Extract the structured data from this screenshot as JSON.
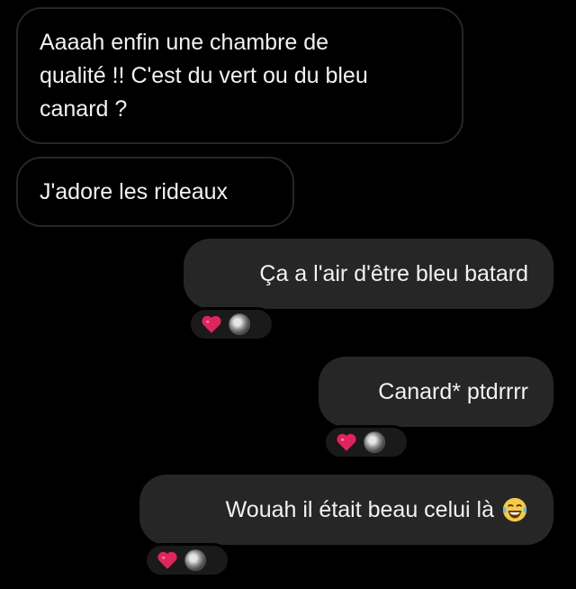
{
  "messages": [
    {
      "text": "Aaaah enfin une chambre de\nqualité !! C'est du vert ou du bleu\ncanard ?",
      "direction": "incoming"
    },
    {
      "text": "J'adore les rideaux",
      "direction": "incoming"
    },
    {
      "text": "Ça a l'air d'être bleu batard",
      "direction": "outgoing",
      "reactions": [
        "heart-emoji",
        "avatar"
      ]
    },
    {
      "text": "Canard* ptdrrrr",
      "direction": "outgoing",
      "reactions": [
        "heart-emoji",
        "avatar"
      ]
    },
    {
      "text": "Wouah il était beau celui là",
      "trailing_emoji": "laughing-tears-emoji",
      "direction": "outgoing",
      "reactions": [
        "heart-emoji",
        "avatar"
      ]
    }
  ],
  "colors": {
    "background": "#000000",
    "incoming_bubble_border": "#262626",
    "outgoing_bubble": "#262626",
    "text": "#f2f2f2",
    "heart": "#e0245e",
    "laugh_face": "#f7c948"
  }
}
